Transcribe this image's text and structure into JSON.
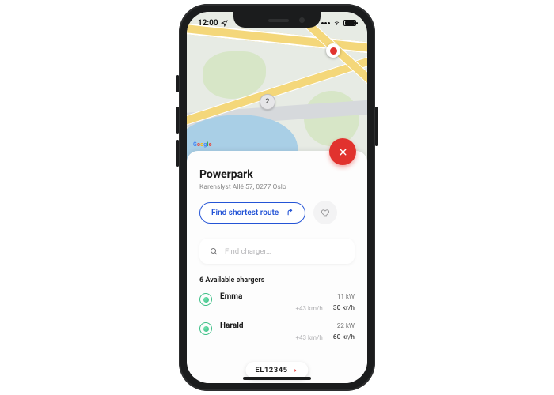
{
  "status": {
    "time": "12:00"
  },
  "map": {
    "cluster_count": "2",
    "attribution_letters": [
      "G",
      "o",
      "o",
      "g",
      "l",
      "e"
    ]
  },
  "panel": {
    "title": "Powerpark",
    "address": "Karenslyst Allé 57, 0277 Oslo",
    "route_button": "Find shortest route"
  },
  "search": {
    "placeholder": "Find charger…"
  },
  "available_label": "6 Available chargers",
  "chargers": [
    {
      "name": "Emma",
      "power": "11 kW",
      "speed": "+43 km/h",
      "price": "30 kr/h"
    },
    {
      "name": "Harald",
      "power": "22 kW",
      "speed": "+43 km/h",
      "price": "60 kr/h"
    }
  ],
  "plate": {
    "text": "EL12345"
  }
}
